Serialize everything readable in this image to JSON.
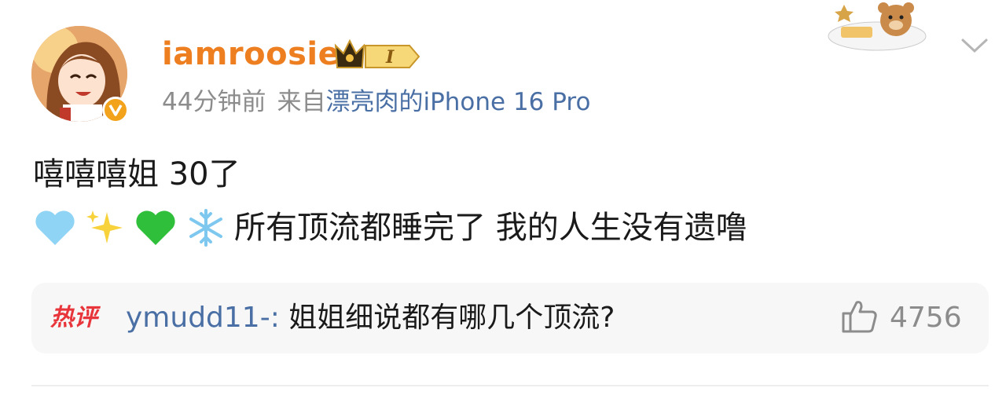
{
  "post": {
    "username": "iamroosie",
    "level_badge": "I",
    "time": "44分钟前",
    "source_prefix": "来自",
    "device": "漂亮肉的iPhone 16 Pro",
    "line1": "嘻嘻嘻姐 30了",
    "line2_text": "所有顶流都睡完了 我的人生没有遗噜",
    "emojis": [
      "light-blue-heart-icon",
      "sparkles-icon",
      "green-heart-icon",
      "snowflake-icon"
    ]
  },
  "hot_comment": {
    "tag": "热评",
    "user": "ymudd11-:",
    "text": " 姐姐细说都有哪几个顶流?",
    "likes": "4756"
  },
  "colors": {
    "username": "#ee7f21",
    "link": "#4a6fa5",
    "meta": "#8c8c8c",
    "hot": "#e8353b"
  }
}
